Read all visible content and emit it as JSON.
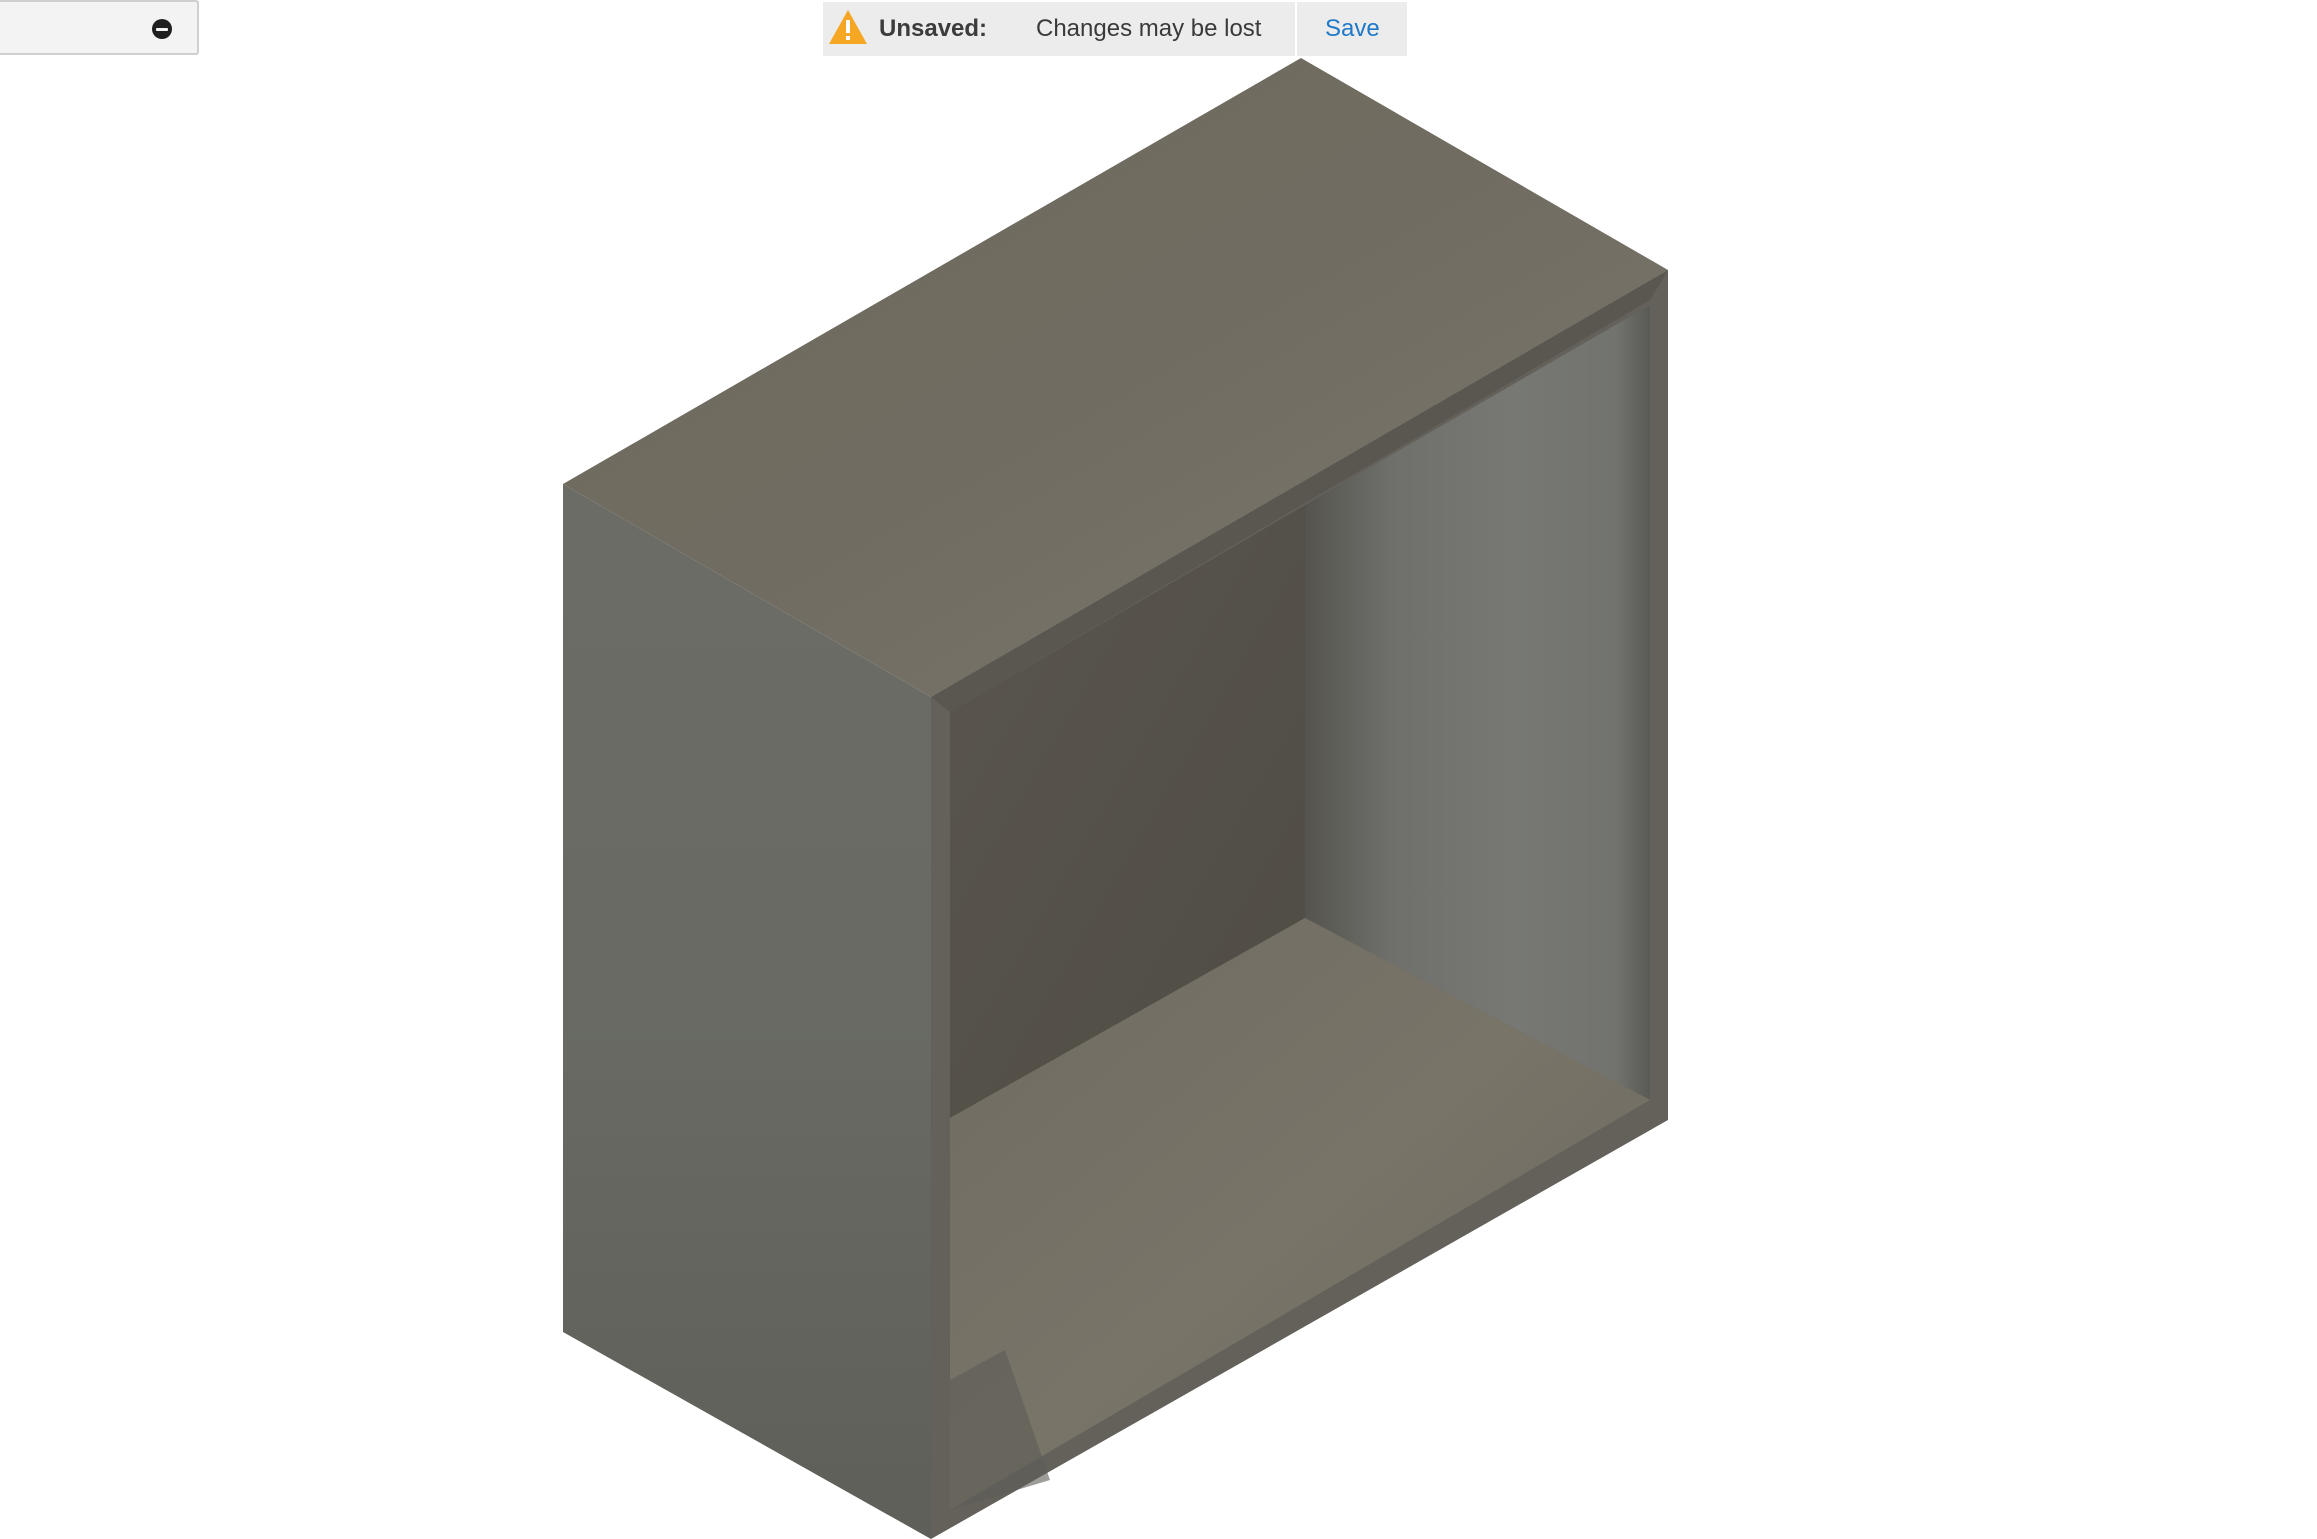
{
  "notification": {
    "icon": "warning-icon",
    "status_label": "Unsaved:",
    "message": "Changes may be lost",
    "save_label": "Save",
    "accent_color": "#1f78c8",
    "warning_color": "#f5a623"
  },
  "browser_pill": {
    "icon": "collapse-icon"
  },
  "model": {
    "shape": "open rectangular box",
    "material_color": "#6f6b62"
  }
}
